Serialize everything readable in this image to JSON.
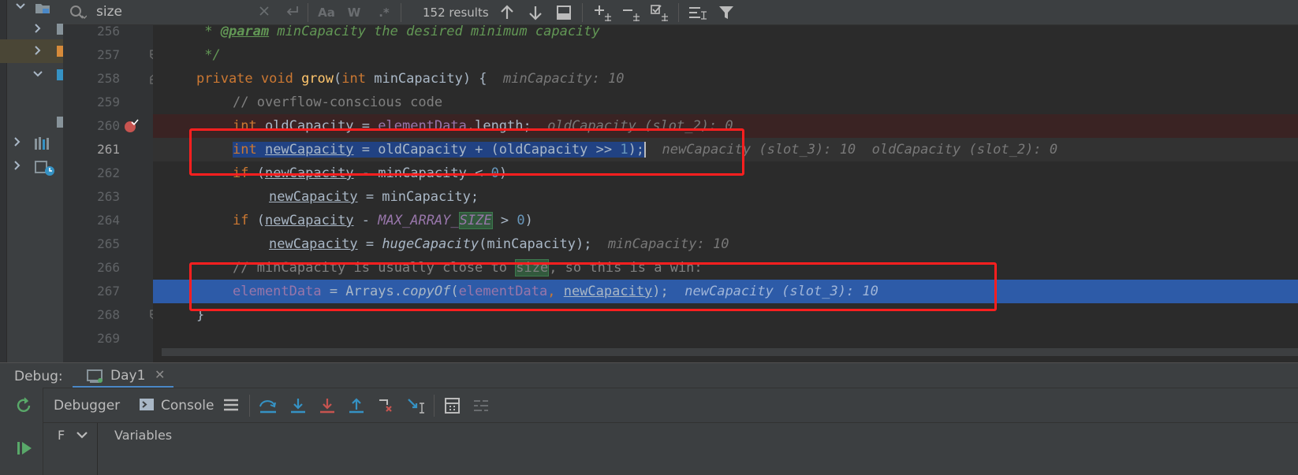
{
  "search": {
    "query": "size",
    "match_case_label": "Aa",
    "words_label": "W",
    "regex_label": ".*",
    "result_count": "152 results"
  },
  "code": {
    "lines": [
      {
        "num": "256",
        "comment_prefix": " * ",
        "tag": "@param",
        "doc": " minCapacity the desired minimum capacity"
      },
      {
        "num": "257",
        "text": " */"
      },
      {
        "num": "258",
        "kw1": "private void ",
        "name": "grow",
        "p1": "(",
        "kw2": "int ",
        "param": "minCapacity",
        "p2": ") {",
        "hint": "minCapacity: 10"
      },
      {
        "num": "259",
        "text": "// overflow-conscious code"
      },
      {
        "num": "260",
        "kw": "int ",
        "var": "oldCapacity",
        "mid": " = ",
        "field": "elementData",
        "rest": ".length;",
        "hint": "oldCapacity (slot_2): 0"
      },
      {
        "num": "261",
        "kw": "int ",
        "var": "newCapacity",
        "mid": " = oldCapacity + (oldCapacity >> ",
        "n": "1",
        "rest": ");",
        "hint1": "newCapacity (slot_3): 10",
        "hint2": "oldCapacity (slot_2): 0"
      },
      {
        "num": "262",
        "kw": "if ",
        "p1": "(",
        "var": "newCapacity",
        "mid": " - minCapacity < ",
        "n": "0",
        "rest": ")"
      },
      {
        "num": "263",
        "var": "newCapacity",
        "rest": " = minCapacity;"
      },
      {
        "num": "264",
        "kw": "if ",
        "p1": "(",
        "var": "newCapacity",
        "mid": " - ",
        "const1": "MAX_ARRAY_",
        "const2": "SIZE",
        "mid2": " > ",
        "n": "0",
        "rest": ")"
      },
      {
        "num": "265",
        "var": "newCapacity",
        "mid": " = ",
        "method": "hugeCapacity",
        "rest": "(minCapacity);",
        "hint": "minCapacity: 10"
      },
      {
        "num": "266",
        "c1": "// minCapacity is usually close to ",
        "c2": "size",
        "c3": ", so this is a win:"
      },
      {
        "num": "267",
        "field1": "elementData",
        "mid": " = Arrays.",
        "method": "copyOf",
        "p1": "(",
        "field2": "elementData",
        "comma": ", ",
        "var": "newCapacity",
        "rest": ");",
        "hint": "newCapacity (slot_3): 10"
      },
      {
        "num": "268",
        "text": "}"
      },
      {
        "num": "269",
        "text": ""
      }
    ]
  },
  "debug": {
    "title": "Debug:",
    "session_tab": "Day1",
    "tabs": {
      "debugger": "Debugger",
      "console": "Console"
    },
    "frames_label": "F",
    "variables_label": "Variables"
  },
  "colors": {
    "accent": "#4a88c7",
    "highlight_box": "#ff1f1f",
    "execution_line": "#2d5ba8",
    "breakpoint": "#c75450"
  }
}
